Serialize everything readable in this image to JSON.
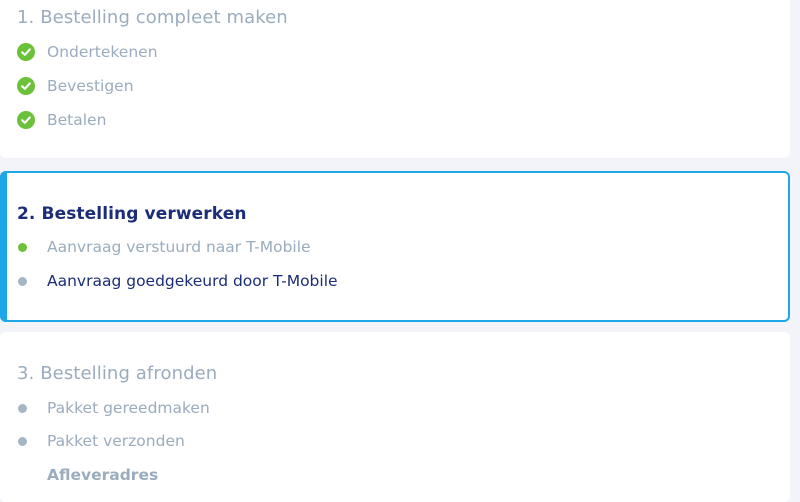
{
  "steps": [
    {
      "title": "1. Bestelling compleet maken",
      "items": [
        {
          "label": "Ondertekenen",
          "status": "done"
        },
        {
          "label": "Bevestigen",
          "status": "done"
        },
        {
          "label": "Betalen",
          "status": "done"
        }
      ]
    },
    {
      "title": "2. Bestelling verwerken",
      "items": [
        {
          "label": "Aanvraag verstuurd naar T-Mobile",
          "status": "completed"
        },
        {
          "label": "Aanvraag goedgekeurd door T-Mobile",
          "status": "current"
        }
      ]
    },
    {
      "title": "3. Bestelling afronden",
      "items": [
        {
          "label": "Pakket gereedmaken",
          "status": "pending"
        },
        {
          "label": "Pakket verzonden",
          "status": "pending"
        }
      ],
      "subheading": "Afleveradres"
    }
  ],
  "colors": {
    "accent": "#1ea7e8",
    "success": "#6cc13a",
    "muted": "#9aacbd",
    "dark": "#1b2d78",
    "pending_dot": "#a6b6c6"
  }
}
